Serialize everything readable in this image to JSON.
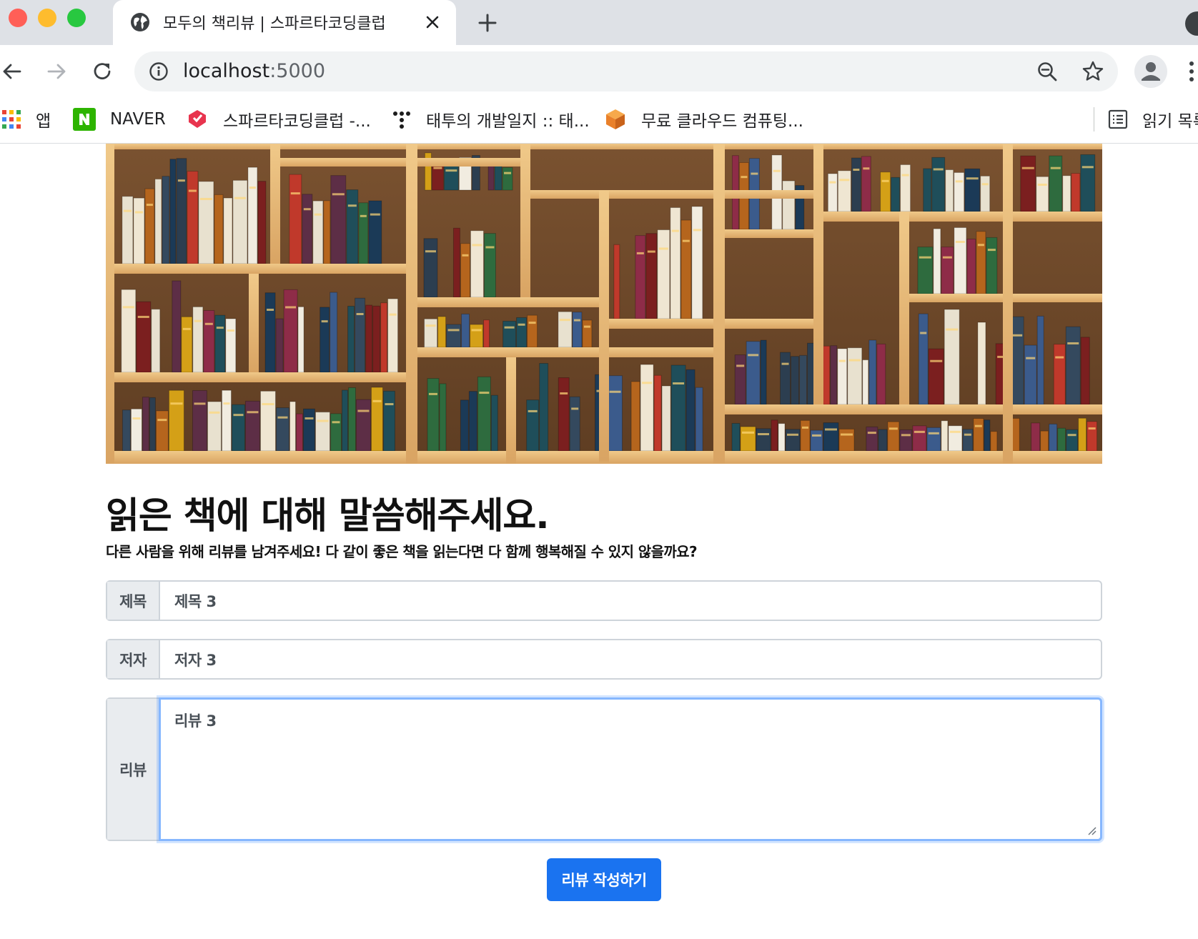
{
  "browser": {
    "tab": {
      "title": "모두의 책리뷰 | 스파르타코딩클럽",
      "favicon": "globe-icon"
    },
    "address": {
      "host": "localhost",
      "port": ":5000"
    },
    "bookmarks": [
      {
        "label": "앱",
        "icon": "apps-grid-icon"
      },
      {
        "label": "NAVER",
        "icon": "naver-icon"
      },
      {
        "label": "스파르타코딩클럽 -...",
        "icon": "sparta-icon"
      },
      {
        "label": "태투의 개발일지 :: 태...",
        "icon": "tistory-icon"
      },
      {
        "label": "무료 클라우드 컴퓨팅...",
        "icon": "aws-cube-icon"
      }
    ],
    "reading_list": {
      "label": "읽기 목록",
      "icon": "reading-list-icon"
    }
  },
  "page": {
    "hero_image": "bookshelf-image",
    "title": "읽은 책에 대해 말씀해주세요.",
    "subtitle": "다른 사람을 위해 리뷰를 남겨주세요! 다 같이 좋은 책을 읽는다면 다 함께 행복해질 수 있지 않을까요?",
    "form": {
      "title_label": "제목",
      "title_value": "제목 3",
      "author_label": "저자",
      "author_value": "저자 3",
      "review_label": "리뷰",
      "review_value": "리뷰 3",
      "submit_label": "리뷰 작성하기"
    }
  },
  "colors": {
    "accent": "#1a73f0",
    "focus_ring": "#86b7fe"
  }
}
